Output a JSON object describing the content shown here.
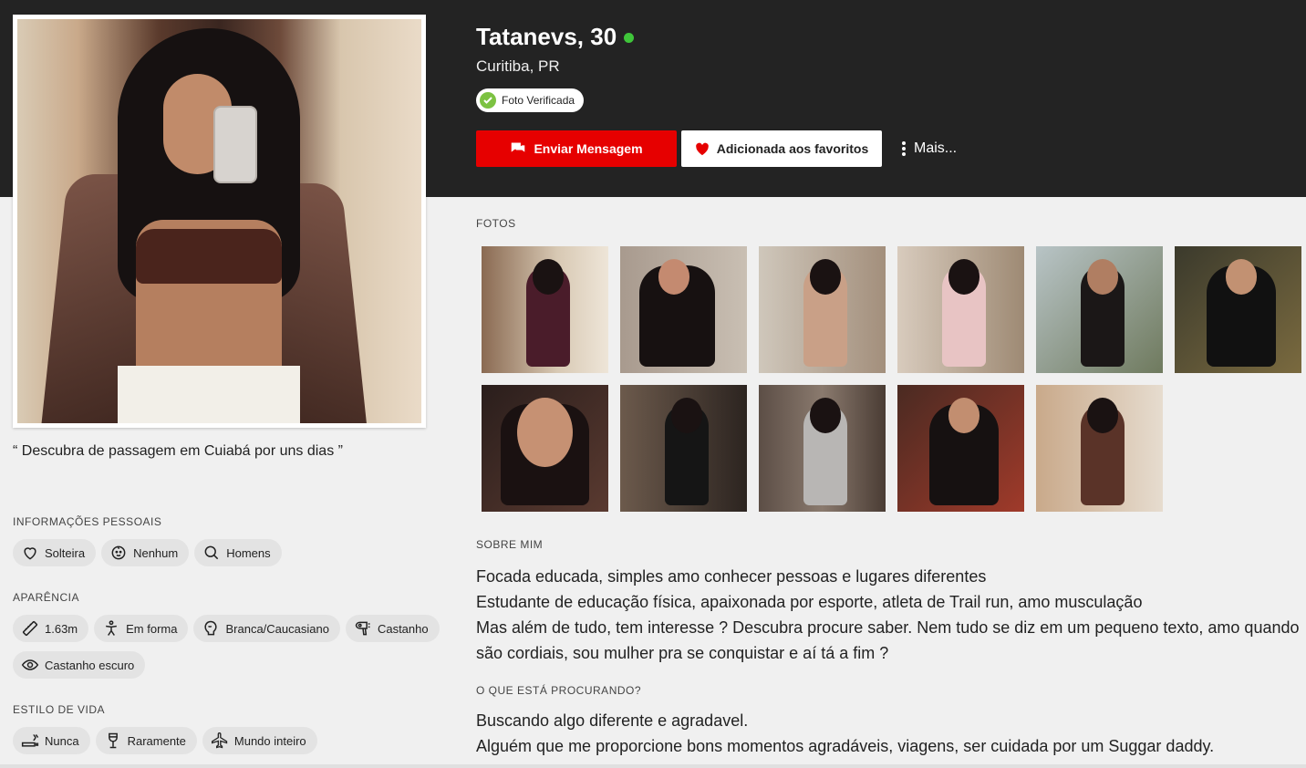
{
  "profile": {
    "name_age": "Tatanevs, 30",
    "location": "Curitiba, PR",
    "verified_label": "Foto Verificada",
    "quote": "“ Descubra de passagem em Cuiabá por uns dias ”"
  },
  "actions": {
    "send_message": "Enviar Mensagem",
    "favorite": "Adicionada aos favoritos",
    "more": "Mais..."
  },
  "colors": {
    "header_bg": "#232323",
    "primary_red": "#e60000",
    "online_green": "#3fc53a",
    "verified_green": "#7cc242"
  },
  "personal_info": {
    "label": "INFORMAÇÕES PESSOAIS",
    "chips": [
      {
        "icon": "heart-outline-icon",
        "text": "Solteira"
      },
      {
        "icon": "baby-face-icon",
        "text": "Nenhum"
      },
      {
        "icon": "search-icon",
        "text": "Homens"
      }
    ]
  },
  "appearance": {
    "label": "APARÊNCIA",
    "chips": [
      {
        "icon": "ruler-icon",
        "text": "1.63m"
      },
      {
        "icon": "body-icon",
        "text": "Em forma"
      },
      {
        "icon": "skin-tone-icon",
        "text": "Branca/Caucasiano"
      },
      {
        "icon": "hair-dryer-icon",
        "text": "Castanho"
      },
      {
        "icon": "eye-icon",
        "text": "Castanho escuro"
      }
    ]
  },
  "lifestyle": {
    "label": "ESTILO DE VIDA",
    "chips": [
      {
        "icon": "smoking-icon",
        "text": "Nunca"
      },
      {
        "icon": "wine-glass-icon",
        "text": "Raramente"
      },
      {
        "icon": "airplane-icon",
        "text": "Mundo inteiro"
      }
    ]
  },
  "photos": {
    "label": "FOTOS",
    "count": 11
  },
  "about": {
    "label": "SOBRE MIM",
    "lines": [
      "Focada educada, simples amo conhecer pessoas e lugares diferentes",
      "Estudante de educação física, apaixonada por esporte, atleta de Trail run, amo musculação",
      "Mas além de tudo, tem interesse ? Descubra procure saber. Nem tudo se diz em um pequeno texto, amo quando",
      "são cordiais, sou mulher pra se conquistar e aí tá a fim ?"
    ]
  },
  "looking_for": {
    "label": "O QUE ESTÁ PROCURANDO?",
    "lines": [
      "Buscando algo diferente e agradavel.",
      "Alguém que me proporcione bons momentos agradáveis, viagens, ser cuidada por um Suggar daddy."
    ]
  }
}
